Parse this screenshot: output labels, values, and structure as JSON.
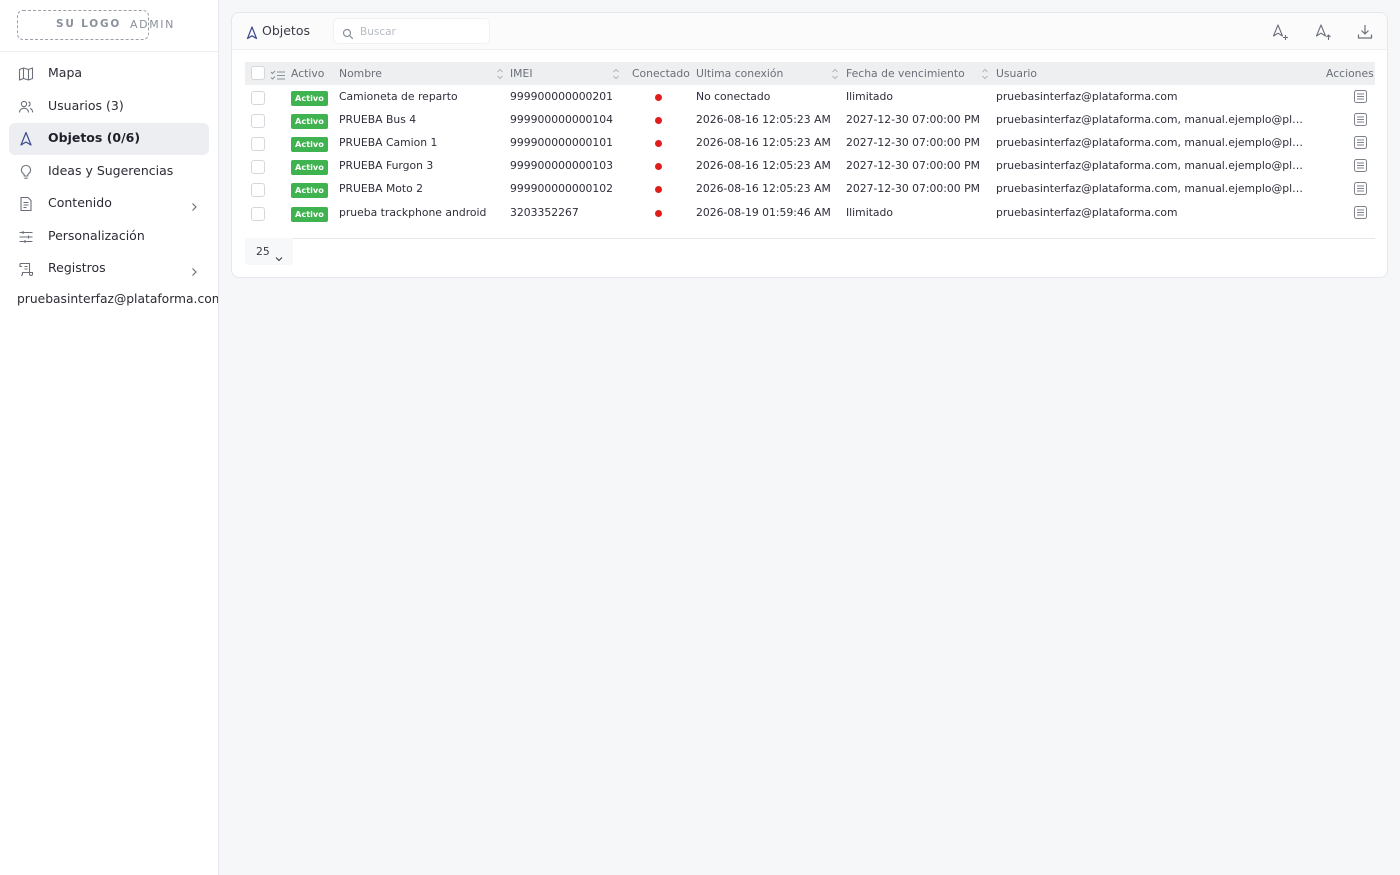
{
  "brand": {
    "logo": "SU LOGO",
    "admin": "ADMIN"
  },
  "sidebar": {
    "items": [
      {
        "label": "Mapa",
        "icon": "map-icon"
      },
      {
        "label": "Usuarios (3)",
        "icon": "users-icon"
      },
      {
        "label": "Objetos (0/6)",
        "icon": "navigation-arrow-icon",
        "active": true
      },
      {
        "label": "Ideas y Sugerencias",
        "icon": "lightbulb-icon"
      },
      {
        "label": "Contenido",
        "icon": "document-icon",
        "expandable": true
      },
      {
        "label": "Personalización",
        "icon": "sliders-icon"
      },
      {
        "label": "Registros",
        "icon": "scroll-log-icon",
        "expandable": true
      }
    ],
    "user": "pruebasinterfaz@plataforma.com (D"
  },
  "panel": {
    "title": "Objetos",
    "search_placeholder": "Buscar",
    "actions": [
      "add-object-icon",
      "import-object-icon",
      "download-icon"
    ]
  },
  "table": {
    "columns": {
      "activo": "Activo",
      "nombre": "Nombre",
      "imei": "IMEI",
      "conectado": "Conectado",
      "ultima": "Ultima conexión",
      "fecha": "Fecha de vencimiento",
      "usuario": "Usuario",
      "acciones": "Acciones"
    },
    "rows": [
      {
        "activo": "Activo",
        "nombre": "Camioneta de reparto",
        "imei": "999900000000201",
        "ultima": "No conectado",
        "fecha": "Ilimitado",
        "usuario": "pruebasinterfaz@plataforma.com"
      },
      {
        "activo": "Activo",
        "nombre": "PRUEBA Bus 4",
        "imei": "999900000000104",
        "ultima": "2026-08-16 12:05:23 AM",
        "fecha": "2027-12-30 07:00:00 PM",
        "usuario": "pruebasinterfaz@plataforma.com, manual.ejemplo@plataforma.com"
      },
      {
        "activo": "Activo",
        "nombre": "PRUEBA Camion 1",
        "imei": "999900000000101",
        "ultima": "2026-08-16 12:05:23 AM",
        "fecha": "2027-12-30 07:00:00 PM",
        "usuario": "pruebasinterfaz@plataforma.com, manual.ejemplo@plataforma.com"
      },
      {
        "activo": "Activo",
        "nombre": "PRUEBA Furgon 3",
        "imei": "999900000000103",
        "ultima": "2026-08-16 12:05:23 AM",
        "fecha": "2027-12-30 07:00:00 PM",
        "usuario": "pruebasinterfaz@plataforma.com, manual.ejemplo@plataforma.com"
      },
      {
        "activo": "Activo",
        "nombre": "PRUEBA Moto 2",
        "imei": "999900000000102",
        "ultima": "2026-08-16 12:05:23 AM",
        "fecha": "2027-12-30 07:00:00 PM",
        "usuario": "pruebasinterfaz@plataforma.com, manual.ejemplo@plataforma.com"
      },
      {
        "activo": "Activo",
        "nombre": "prueba trackphone android",
        "imei": "3203352267",
        "ultima": "2026-08-19 01:59:46 AM",
        "fecha": "Ilimitado",
        "usuario": "pruebasinterfaz@plataforma.com"
      }
    ],
    "page_size": "25"
  },
  "colors": {
    "active_badge": "#3fb34f",
    "disconnected_dot": "#e01c1c",
    "accent": "#3b4a8a"
  }
}
